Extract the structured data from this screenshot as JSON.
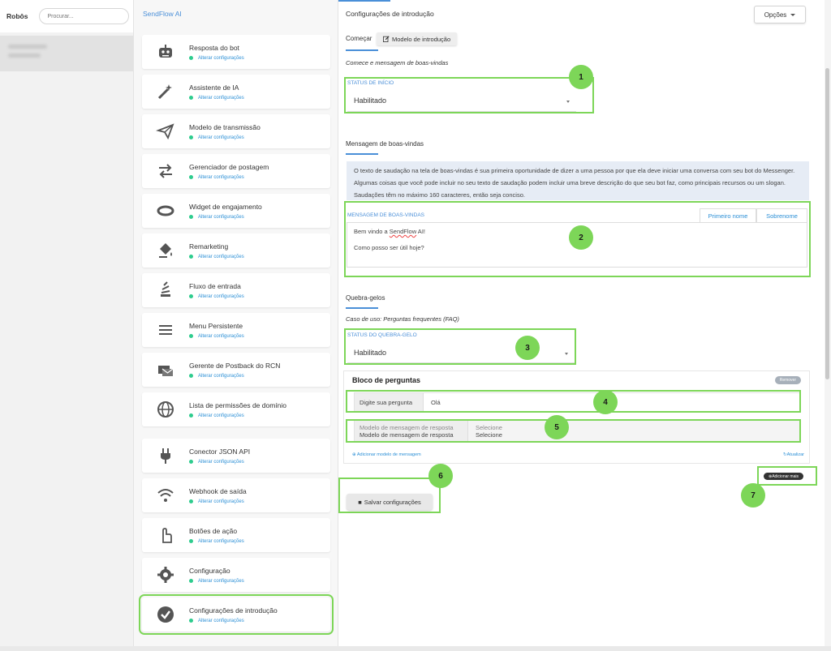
{
  "bots": {
    "title": "Robôs",
    "search_placeholder": "Procurar..."
  },
  "brand": "SendFlow AI",
  "menu": [
    {
      "label": "Resposta do bot",
      "sub": "Alterar configurações",
      "icon": "robot-icon"
    },
    {
      "label": "Assistente de IA",
      "sub": "Alterar configurações",
      "icon": "magic-wand-icon"
    },
    {
      "label": "Modelo de transmissão",
      "sub": "Alterar configurações",
      "icon": "paper-plane-icon"
    },
    {
      "label": "Gerenciador de postagem",
      "sub": "Alterar configurações",
      "icon": "exchange-arrows-icon"
    },
    {
      "label": "Widget de engajamento",
      "sub": "Alterar configurações",
      "icon": "ring-icon"
    },
    {
      "label": "Remarketing",
      "sub": "Alterar configurações",
      "icon": "paint-bucket-icon"
    },
    {
      "label": "Fluxo de entrada",
      "sub": "Alterar configurações",
      "icon": "stack-icon"
    },
    {
      "label": "Menu Persistente",
      "sub": "Alterar configurações",
      "icon": "hamburger-menu-icon"
    },
    {
      "label": "Gerente de Postback do RCN",
      "sub": "Alterar configurações",
      "icon": "mail-stack-icon"
    },
    {
      "label": "Lista de permissões de domínio",
      "sub": "Alterar configurações",
      "icon": "globe-icon"
    },
    {
      "label": "Conector JSON API",
      "sub": "Alterar configurações",
      "icon": "plug-icon"
    },
    {
      "label": "Webhook de saída",
      "sub": "Alterar configurações",
      "icon": "wifi-icon"
    },
    {
      "label": "Botões de ação",
      "sub": "Alterar configurações",
      "icon": "pointer-hand-icon"
    },
    {
      "label": "Configuração",
      "sub": "Alterar configurações",
      "icon": "gear-icon"
    },
    {
      "label": "Configurações de introdução",
      "sub": "Alterar configurações",
      "icon": "check-circle-icon"
    }
  ],
  "main": {
    "title": "Configurações de introdução",
    "options_label": "Opções",
    "start": {
      "tab": "Começar",
      "template_chip": "Modelo de introdução",
      "note": "Comece e mensagem de boas-vindas",
      "status_label": "STATUS DE INÍCIO",
      "status_value": "Habilitado"
    },
    "welcome": {
      "tab": "Mensagem de boas-vindas",
      "info": "O texto de saudação na tela de boas-vindas é sua primeira oportunidade de dizer a uma pessoa por que ela deve iniciar uma conversa com seu bot do Messenger. Algumas coisas que você pode incluir no seu texto de saudação podem incluir uma breve descrição do que seu bot faz, como principais recursos ou um slogan. Saudações têm no máximo 160 caracteres, então seja conciso.",
      "field_label": "MENSAGEM DE BOAS-VINDAS",
      "first_name_btn": "Primeiro nome",
      "last_name_btn": "Sobrenome",
      "line1_a": "Bem vindo a ",
      "line1_b": "SendFlow",
      "line1_c": " AI!",
      "line2": "Como posso ser útil hoje?"
    },
    "icebreaker": {
      "tab": "Quebra-gelos",
      "note": "Caso de uso: Perguntas frequentes (FAQ)",
      "status_label": "STATUS DO QUEBRA-GELO",
      "status_value": "Habilitado",
      "block_title": "Bloco de perguntas",
      "remove_label": "Remover",
      "question_label": "Digite sua pergunta",
      "question_value": "Olá",
      "reply_label_ghost": "Modelo de mensagem de resposta",
      "reply_value_ghost": "Selecione",
      "reply_label": "Modelo de mensagem de resposta",
      "reply_value": "Selecione",
      "add_template": "Adicionar modelo de mensagem",
      "refresh": "Atualizar"
    },
    "save_label": "Salvar configurações",
    "add_more_label": "Adicionar mais"
  },
  "annotations": [
    "1",
    "2",
    "3",
    "4",
    "5",
    "6",
    "7"
  ],
  "colors": {
    "accent": "#4a8fd8",
    "highlight": "#7dd658",
    "status_dot": "#2ecc8e"
  }
}
